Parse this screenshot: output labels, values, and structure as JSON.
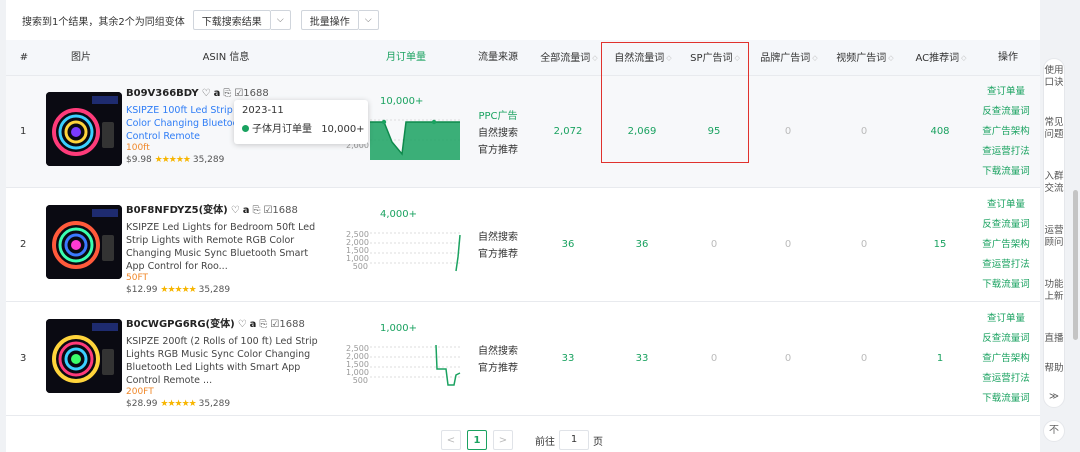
{
  "toolbar": {
    "summary": "搜索到1个结果，其余2个为同组变体",
    "download_label": "下载搜索结果",
    "batch_label": "批量操作"
  },
  "columns": {
    "index": "#",
    "image": "图片",
    "asin": "ASIN 信息",
    "monthly_orders": "月订单量",
    "traffic_source": "流量来源",
    "all_keywords": "全部流量词",
    "organic_keywords": "自然流量词",
    "sp_keywords": "SP广告词",
    "brand_keywords": "品牌广告词",
    "video_keywords": "视频广告词",
    "ac_keywords": "AC推荐词",
    "actions": "操作"
  },
  "rows": [
    {
      "index": "1",
      "asin": "B09V366BDY",
      "title": "KSIPZE 100ft Led Strip Lights Music Sync Color Changing Bluetooth Smart App Control Remote",
      "variant": "100ft",
      "price": "$9.98",
      "rating": "★★★★★",
      "reviews": "35,289",
      "chart_label": "10,000+",
      "traffic_sources": [
        "PPC广告",
        "自然搜索",
        "官方推荐"
      ],
      "all": "2,072",
      "organic": "2,069",
      "sp": "95",
      "brand": "0",
      "video": "0",
      "ac": "408"
    },
    {
      "index": "2",
      "asin": "B0F8NFDYZ5(变体)",
      "title": "KSIPZE Led Lights for Bedroom 50ft Led Strip Lights with Remote RGB Color Changing Music Sync Bluetooth Smart App Control for Roo...",
      "variant": "50FT",
      "price": "$12.99",
      "rating": "★★★★★",
      "reviews": "35,289",
      "chart_label": "4,000+",
      "traffic_sources": [
        "自然搜索",
        "官方推荐"
      ],
      "all": "36",
      "organic": "36",
      "sp": "0",
      "brand": "0",
      "video": "0",
      "ac": "15"
    },
    {
      "index": "3",
      "asin": "B0CWGPG6RG(变体)",
      "title": "KSIPZE 200ft (2 Rolls of 100 ft) Led Strip Lights RGB Music Sync Color Changing Bluetooth Led Lights with Smart App Control Remote ...",
      "variant": "200FT",
      "price": "$28.99",
      "rating": "★★★★★",
      "reviews": "35,289",
      "chart_label": "1,000+",
      "traffic_sources": [
        "自然搜索",
        "官方推荐"
      ],
      "all": "33",
      "organic": "33",
      "sp": "0",
      "brand": "0",
      "video": "0",
      "ac": "1"
    }
  ],
  "chart_ticks": {
    "row1": [
      "0",
      "0",
      "0",
      "2,000"
    ],
    "row2": [
      "2,500",
      "2,000",
      "1,500",
      "1,000",
      "500"
    ],
    "row3": [
      "2,500",
      "2,000",
      "1,500",
      "1,000",
      "500"
    ]
  },
  "actions": [
    "查订单量",
    "反查流量词",
    "查广告架构",
    "查运营打法",
    "下载流量词"
  ],
  "ico_1688": "☑1688",
  "tooltip": {
    "date": "2023-11",
    "series": "子体月订单量",
    "value": "10,000+"
  },
  "pagination": {
    "prev": "<",
    "current": "1",
    "next": ">",
    "goto_label": "前往",
    "goto_value": "1",
    "page_label": "页"
  },
  "sidebar": {
    "items": [
      "使用口诀",
      "常见问题",
      "入群交流",
      "运营顾问",
      "功能上新",
      "直播",
      "帮助"
    ],
    "collapse": "≫",
    "top": "不"
  },
  "colors": {
    "accent": "#1aa260",
    "link": "#2f7df6",
    "variant": "#f0882a",
    "highlight_box": "#e0322d"
  }
}
